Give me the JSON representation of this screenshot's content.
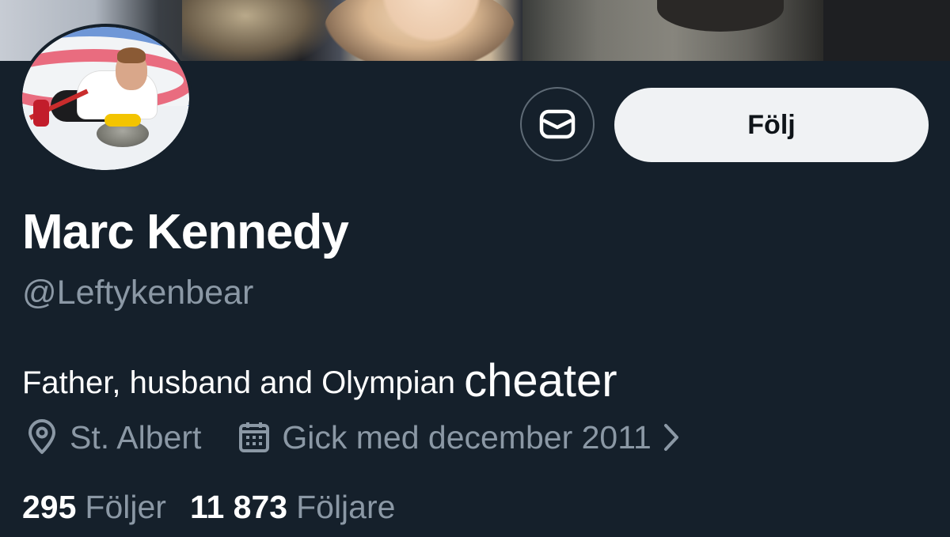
{
  "profile": {
    "display_name": "Marc Kennedy",
    "handle": "@Leftykenbear",
    "bio_text": "Father, husband and Olympian",
    "bio_emphasis": "cheater",
    "location": "St. Albert",
    "joined": "Gick med december 2011"
  },
  "actions": {
    "follow_label": "Följ",
    "message_icon": "envelope-icon"
  },
  "stats": {
    "following_count": "295",
    "following_label": "Följer",
    "followers_count": "11 873",
    "followers_label": "Följare"
  },
  "icons": {
    "location": "location-pin-icon",
    "joined": "calendar-icon",
    "joined_more": "chevron-right-icon"
  },
  "colors": {
    "background": "#15202b",
    "primary_text": "#ffffff",
    "secondary_text": "#8b98a5",
    "follow_button_bg": "#f0f2f4",
    "follow_button_text": "#0f1419"
  }
}
